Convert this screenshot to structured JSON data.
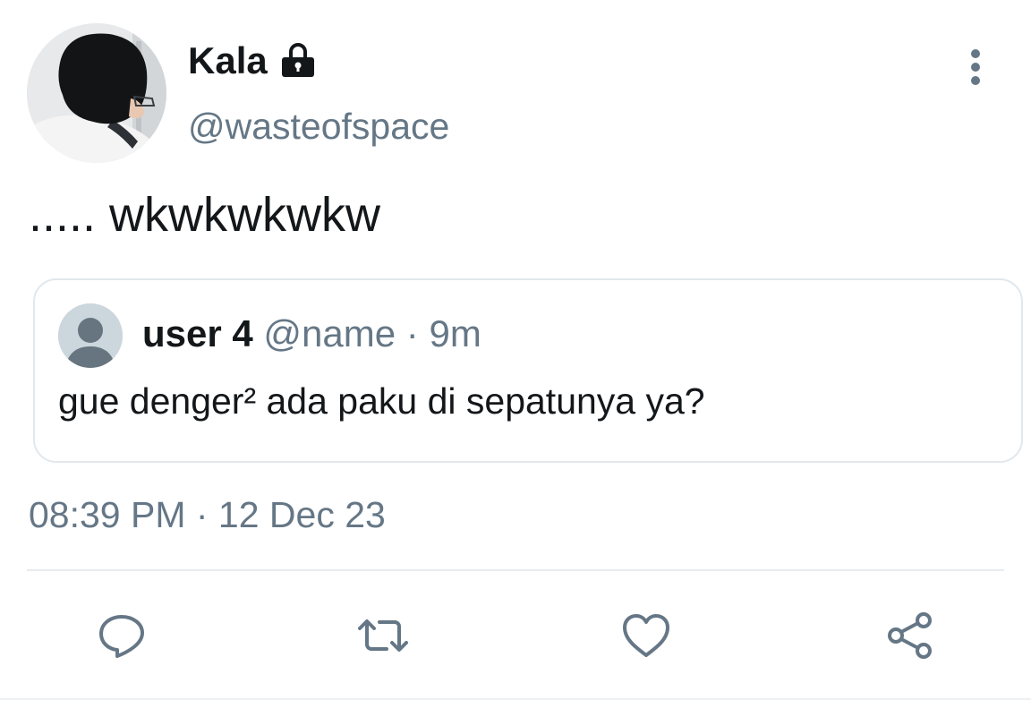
{
  "tweet": {
    "author": {
      "display_name": "Kala",
      "handle": "@wasteofspace",
      "protected_icon": "lock-icon"
    },
    "text": "..... wkwkwkwkw",
    "timestamp": "08:39 PM · 12 Dec 23",
    "more_icon": "more-vertical-icon"
  },
  "quoted_tweet": {
    "display_name": "user 4",
    "handle": "@name",
    "separator": "·",
    "time": "9m",
    "text": "gue denger² ada paku di sepatunya ya?"
  },
  "actions": [
    {
      "icon": "reply-icon"
    },
    {
      "icon": "retweet-icon"
    },
    {
      "icon": "like-icon"
    },
    {
      "icon": "share-icon"
    }
  ],
  "colors": {
    "text_primary": "#14171a",
    "text_secondary": "#657786",
    "border": "#e1e8ed"
  }
}
